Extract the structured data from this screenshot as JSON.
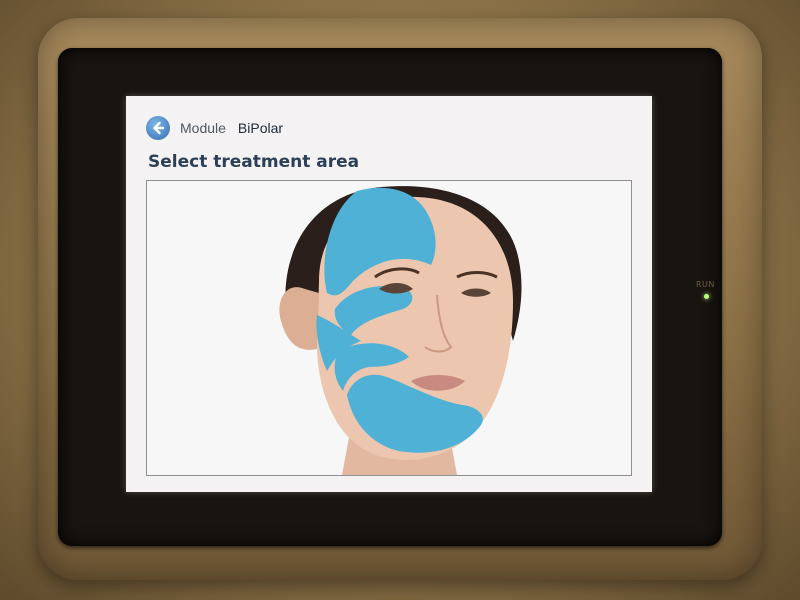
{
  "header": {
    "module_label": "Module",
    "module_value": "BiPolar"
  },
  "page": {
    "title": "Select treatment area"
  },
  "device": {
    "indicator_label": "RUN"
  },
  "colors": {
    "zone": "#4fb1d6",
    "title": "#2b3f58",
    "back_button": "#3d7fc1"
  },
  "icons": {
    "back": "back-arrow-icon"
  }
}
